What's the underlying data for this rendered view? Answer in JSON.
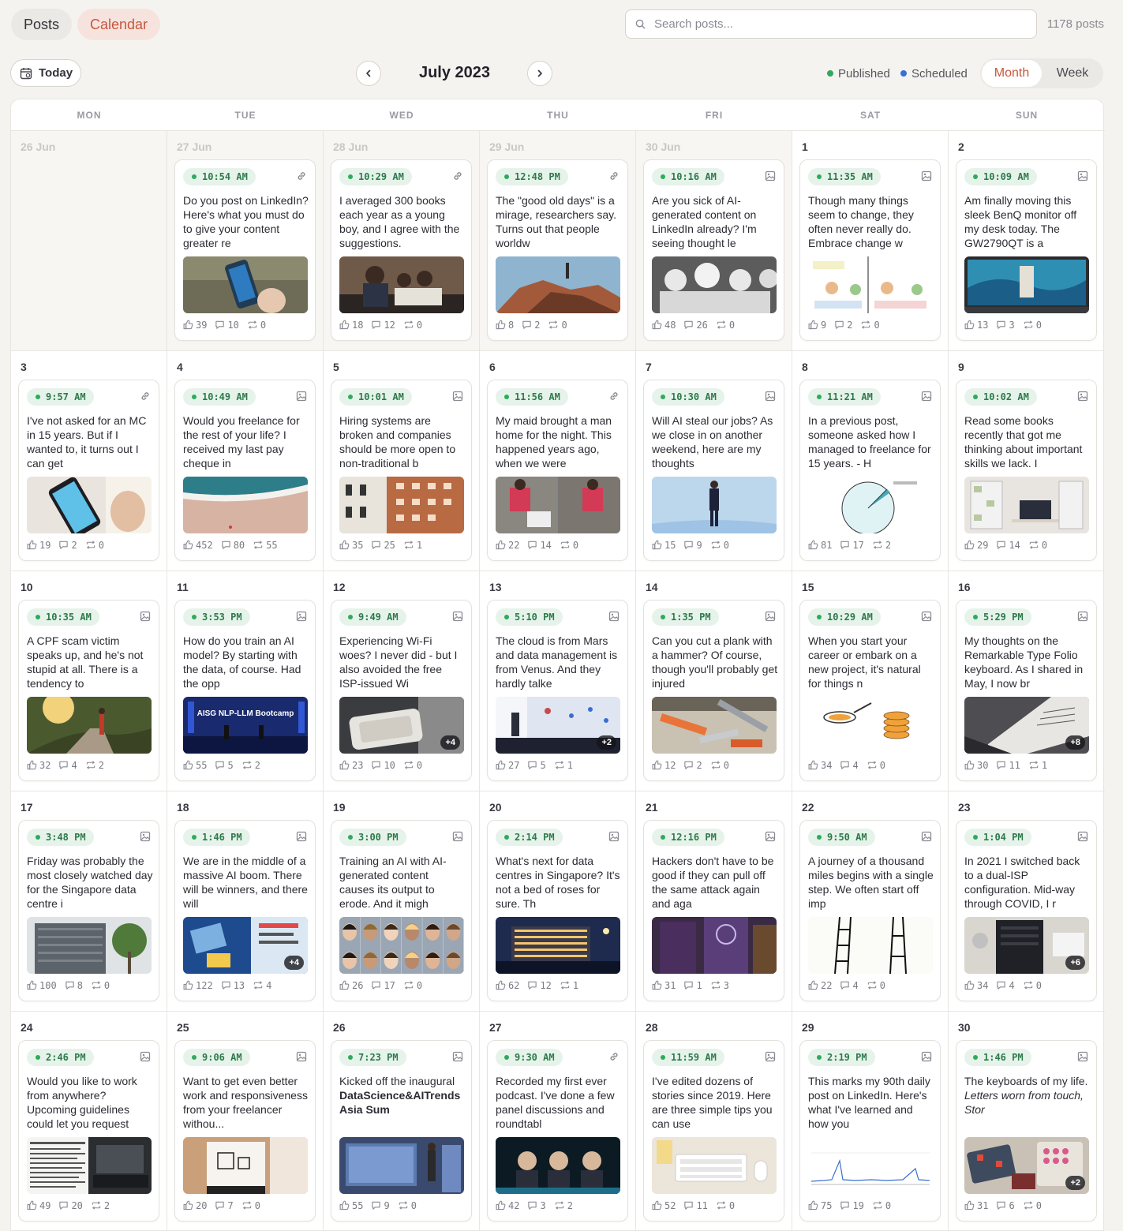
{
  "tabs": {
    "posts": "Posts",
    "calendar": "Calendar"
  },
  "search": {
    "placeholder": "Search posts..."
  },
  "post_count": "1178 posts",
  "toolbar": {
    "today": "Today",
    "month_title": "July 2023"
  },
  "legend": {
    "published": {
      "label": "Published",
      "color": "#2faa5c"
    },
    "scheduled": {
      "label": "Scheduled",
      "color": "#3b6fd1"
    }
  },
  "views": {
    "month": "Month",
    "week": "Week"
  },
  "weekdays": [
    "MON",
    "TUE",
    "WED",
    "THU",
    "FRI",
    "SAT",
    "SUN"
  ],
  "colors": {
    "accent": "#c5573d",
    "published_bg": "#e6f3ea",
    "published_text": "#2d7a4b"
  },
  "days": [
    {
      "label": "26 Jun",
      "outside": true,
      "post": null
    },
    {
      "label": "27 Jun",
      "outside": true,
      "post": {
        "time": "10:54 AM",
        "type_icon": "link-icon",
        "text": "Do you post on LinkedIn? Here's what you must do to give your content greater re",
        "likes": "39",
        "comments": "10",
        "reposts": "0",
        "thumb": "phone-linkedin"
      }
    },
    {
      "label": "28 Jun",
      "outside": true,
      "post": {
        "time": "10:29 AM",
        "type_icon": "link-icon",
        "text": "I averaged 300 books each year as a young boy, and I agree with the suggestions.",
        "likes": "18",
        "comments": "12",
        "reposts": "0",
        "thumb": "family-reading"
      }
    },
    {
      "label": "29 Jun",
      "outside": true,
      "post": {
        "time": "12:48 PM",
        "type_icon": "link-icon",
        "text": "The \"good old days\" is a mirage, researchers say. Turns out that people worldw",
        "likes": "8",
        "comments": "2",
        "reposts": "0",
        "thumb": "mountain"
      }
    },
    {
      "label": "30 Jun",
      "outside": true,
      "post": {
        "time": "10:16 AM",
        "type_icon": "image-icon",
        "text": "Are you sick of AI-generated content on LinkedIn already? I'm seeing thought le",
        "likes": "48",
        "comments": "26",
        "reposts": "0",
        "thumb": "stormtroopers"
      }
    },
    {
      "label": "1",
      "outside": false,
      "post": {
        "time": "11:35 AM",
        "type_icon": "image-icon",
        "text": "Though many things seem to change, they often never really do. Embrace change w",
        "likes": "9",
        "comments": "2",
        "reposts": "0",
        "thumb": "comic"
      }
    },
    {
      "label": "2",
      "outside": false,
      "post": {
        "time": "10:09 AM",
        "type_icon": "image-icon",
        "text": "Am finally moving this sleek BenQ monitor off my desk today. The GW2790QT is a",
        "likes": "13",
        "comments": "3",
        "reposts": "0",
        "thumb": "monitor"
      }
    },
    {
      "label": "3",
      "outside": false,
      "post": {
        "time": "9:57 AM",
        "type_icon": "link-icon",
        "text": "I've not asked for an MC in 15 years. But if I wanted to, it turns out I can get",
        "likes": "19",
        "comments": "2",
        "reposts": "0",
        "thumb": "phone-app"
      }
    },
    {
      "label": "4",
      "outside": false,
      "post": {
        "time": "10:49 AM",
        "type_icon": "image-icon",
        "text": "Would you freelance for the rest of your life? I received my last pay cheque in",
        "likes": "452",
        "comments": "80",
        "reposts": "55",
        "thumb": "beach"
      }
    },
    {
      "label": "5",
      "outside": false,
      "post": {
        "time": "10:01 AM",
        "type_icon": "image-icon",
        "text": "Hiring systems are broken and companies should be more open to non-traditional b",
        "likes": "35",
        "comments": "25",
        "reposts": "1",
        "thumb": "buildings"
      }
    },
    {
      "label": "6",
      "outside": false,
      "post": {
        "time": "11:56 AM",
        "type_icon": "link-icon",
        "text": "My maid brought a man home for the night. This happened years ago, when we were",
        "likes": "22",
        "comments": "14",
        "reposts": "0",
        "thumb": "delivery"
      }
    },
    {
      "label": "7",
      "outside": false,
      "post": {
        "time": "10:30 AM",
        "type_icon": "image-icon",
        "text": "Will AI steal our jobs? As we close in on another weekend, here are my thoughts",
        "likes": "15",
        "comments": "9",
        "reposts": "0",
        "thumb": "man-suit"
      }
    },
    {
      "label": "8",
      "outside": false,
      "post": {
        "time": "11:21 AM",
        "type_icon": "image-icon",
        "text": "In a previous post, someone asked how I managed to freelance for 15 years. - H",
        "likes": "81",
        "comments": "17",
        "reposts": "2",
        "thumb": "pie"
      }
    },
    {
      "label": "9",
      "outside": false,
      "post": {
        "time": "10:02 AM",
        "type_icon": "image-icon",
        "text": "Read some books recently that got me thinking about important skills we lack. I",
        "likes": "29",
        "comments": "14",
        "reposts": "0",
        "thumb": "desk-room"
      }
    },
    {
      "label": "10",
      "outside": false,
      "post": {
        "time": "10:35 AM",
        "type_icon": "image-icon",
        "text": "A CPF scam victim speaks up, and he's not stupid at all. There is a tendency to",
        "likes": "32",
        "comments": "4",
        "reposts": "2",
        "thumb": "park"
      }
    },
    {
      "label": "11",
      "outside": false,
      "post": {
        "time": "3:53 PM",
        "type_icon": "image-icon",
        "text": "How do you train an AI model? By starting with the data, of course. Had the opp",
        "likes": "55",
        "comments": "5",
        "reposts": "2",
        "thumb": "stage-blue",
        "thumb_text": "AISG NLP-LLM Bootcamp"
      }
    },
    {
      "label": "12",
      "outside": false,
      "post": {
        "time": "9:49 AM",
        "type_icon": "image-icon",
        "text": "Experiencing Wi-Fi woes? I never did - but I also avoided the free ISP-issued Wi",
        "likes": "23",
        "comments": "10",
        "reposts": "0",
        "thumb": "router",
        "more": "+4"
      }
    },
    {
      "label": "13",
      "outside": false,
      "post": {
        "time": "5:10 PM",
        "type_icon": "image-icon",
        "text": "The cloud is from Mars and data management is from Venus. And they hardly talke",
        "likes": "27",
        "comments": "5",
        "reposts": "1",
        "thumb": "conference",
        "more": "+2"
      }
    },
    {
      "label": "14",
      "outside": false,
      "post": {
        "time": "1:35 PM",
        "type_icon": "image-icon",
        "text": "Can you cut a plank with a hammer? Of course, though you'll probably get injured",
        "likes": "12",
        "comments": "2",
        "reposts": "0",
        "thumb": "tools"
      }
    },
    {
      "label": "15",
      "outside": false,
      "post": {
        "time": "10:29 AM",
        "type_icon": "image-icon",
        "text": "When you start your career or embark on a new project, it's natural for things n",
        "likes": "34",
        "comments": "4",
        "reposts": "0",
        "thumb": "pancakes"
      }
    },
    {
      "label": "16",
      "outside": false,
      "post": {
        "time": "5:29 PM",
        "type_icon": "image-icon",
        "text": "My thoughts on the Remarkable Type Folio keyboard. As I shared in May, I now br",
        "likes": "30",
        "comments": "11",
        "reposts": "1",
        "thumb": "keyboard-folio",
        "more": "+8"
      }
    },
    {
      "label": "17",
      "outside": false,
      "post": {
        "time": "3:48 PM",
        "type_icon": "image-icon",
        "text": "Friday was probably the most closely watched day for the Singapore data centre i",
        "likes": "100",
        "comments": "8",
        "reposts": "0",
        "thumb": "datacentre"
      }
    },
    {
      "label": "18",
      "outside": false,
      "post": {
        "time": "1:46 PM",
        "type_icon": "image-icon",
        "text": "We are in the middle of a massive AI boom. There will be winners, and there will",
        "likes": "122",
        "comments": "13",
        "reposts": "4",
        "thumb": "collage",
        "more": "+4"
      }
    },
    {
      "label": "19",
      "outside": false,
      "post": {
        "time": "3:00 PM",
        "type_icon": "image-icon",
        "text": "Training an AI with AI-generated content causes its output to erode. And it migh",
        "likes": "26",
        "comments": "17",
        "reposts": "0",
        "thumb": "faces"
      }
    },
    {
      "label": "20",
      "outside": false,
      "post": {
        "time": "2:14 PM",
        "type_icon": "image-icon",
        "text": "What's next for data centres in Singapore? It's not a bed of roses for sure. Th",
        "likes": "62",
        "comments": "12",
        "reposts": "1",
        "thumb": "night-building"
      }
    },
    {
      "label": "21",
      "outside": false,
      "post": {
        "time": "12:16 PM",
        "type_icon": "image-icon",
        "text": "Hackers don't have to be good if they can pull off the same attack again and aga",
        "likes": "31",
        "comments": "1",
        "reposts": "3",
        "thumb": "banners"
      }
    },
    {
      "label": "22",
      "outside": false,
      "post": {
        "time": "9:50 AM",
        "type_icon": "image-icon",
        "text": "A journey of a thousand miles begins with a single step. We often start off imp",
        "likes": "22",
        "comments": "4",
        "reposts": "0",
        "thumb": "ladders"
      }
    },
    {
      "label": "23",
      "outside": false,
      "post": {
        "time": "1:04 PM",
        "type_icon": "image-icon",
        "text": "In 2021 I switched back to a dual-ISP configuration. Mid-way through COVID, I r",
        "likes": "34",
        "comments": "4",
        "reposts": "0",
        "thumb": "network",
        "more": "+6"
      }
    },
    {
      "label": "24",
      "outside": false,
      "post": {
        "time": "2:46 PM",
        "type_icon": "image-icon",
        "text": "Would you like to work from anywhere? Upcoming guidelines could let you request",
        "likes": "49",
        "comments": "20",
        "reposts": "2",
        "thumb": "laptop-news"
      }
    },
    {
      "label": "25",
      "outside": false,
      "post": {
        "time": "9:06 AM",
        "type_icon": "image-icon",
        "text": "Want to get even better work and responsiveness from your freelancer withou...",
        "likes": "20",
        "comments": "7",
        "reposts": "0",
        "thumb": "welcome-mat"
      }
    },
    {
      "label": "26",
      "outside": false,
      "post": {
        "time": "7:23 PM",
        "type_icon": "image-icon",
        "text_plain": "Kicked off the inaugural",
        "text_bold": "DataScience&AITrends Asia Sum",
        "likes": "55",
        "comments": "9",
        "reposts": "0",
        "thumb": "presentation"
      }
    },
    {
      "label": "27",
      "outside": false,
      "post": {
        "time": "9:30 AM",
        "type_icon": "link-icon",
        "text": "Recorded my first ever podcast. I've done a few panel discussions and roundtabl",
        "likes": "42",
        "comments": "3",
        "reposts": "2",
        "thumb": "podcast"
      }
    },
    {
      "label": "28",
      "outside": false,
      "post": {
        "time": "11:59 AM",
        "type_icon": "image-icon",
        "text": "I've edited dozens of stories since 2019. Here are three simple tips you can use",
        "likes": "52",
        "comments": "11",
        "reposts": "0",
        "thumb": "desk-keyboard"
      }
    },
    {
      "label": "29",
      "outside": false,
      "post": {
        "time": "2:19 PM",
        "type_icon": "image-icon",
        "text": "This marks my 90th daily post on LinkedIn. Here's what I've learned and how you",
        "likes": "75",
        "comments": "19",
        "reposts": "0",
        "thumb": "graph"
      }
    },
    {
      "label": "30",
      "outside": false,
      "post": {
        "time": "1:46 PM",
        "type_icon": "image-icon",
        "text_plain": "The keyboards of my life.",
        "text_italic": "Letters worn from touch, Stor",
        "likes": "31",
        "comments": "6",
        "reposts": "0",
        "thumb": "keyboards",
        "more": "+2"
      }
    }
  ]
}
